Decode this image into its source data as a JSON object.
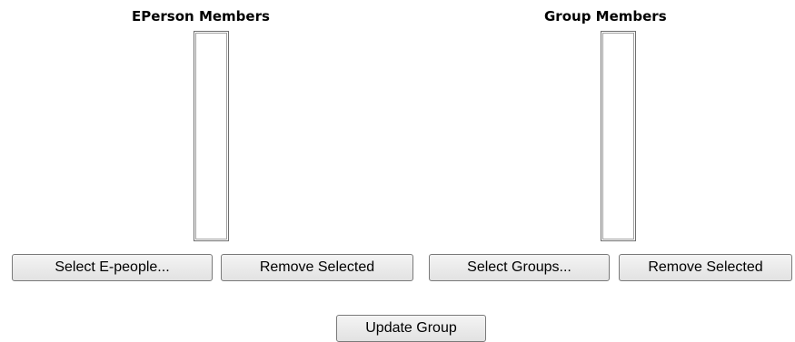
{
  "eperson_section": {
    "heading": "EPerson Members",
    "select_button": "Select E-people...",
    "remove_button": "Remove Selected"
  },
  "group_section": {
    "heading": "Group Members",
    "select_button": "Select Groups...",
    "remove_button": "Remove Selected"
  },
  "update_button": "Update Group"
}
